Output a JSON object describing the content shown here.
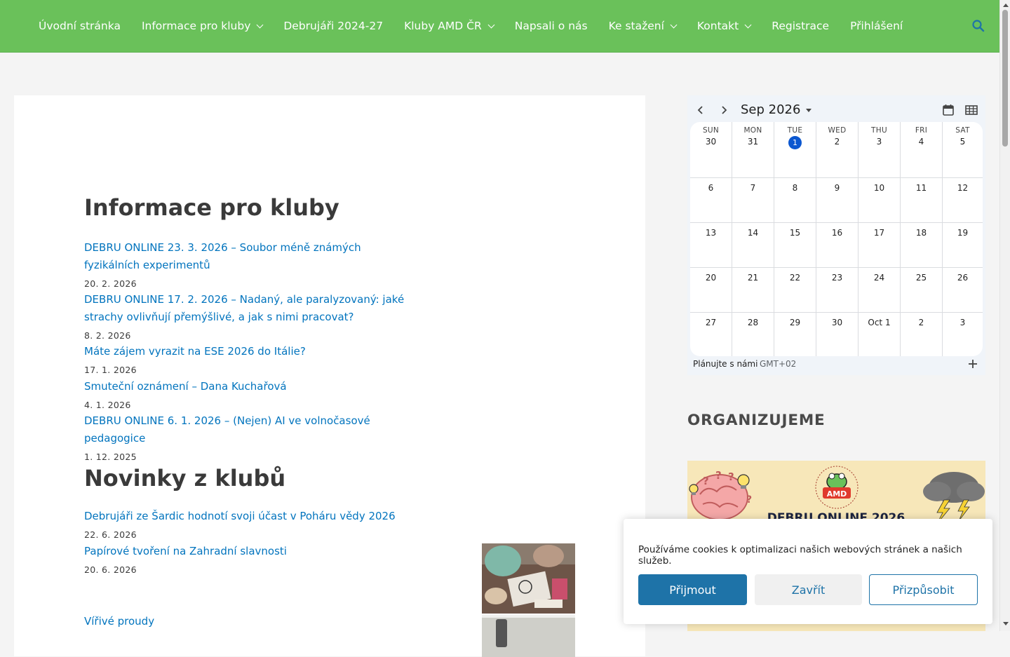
{
  "nav": {
    "items": [
      {
        "label": "Úvodní stránka",
        "has_dropdown": false
      },
      {
        "label": "Informace pro kluby",
        "has_dropdown": true
      },
      {
        "label": "Debrujáři 2024-27",
        "has_dropdown": false
      },
      {
        "label": "Kluby AMD ČR",
        "has_dropdown": true
      },
      {
        "label": "Napsali o nás",
        "has_dropdown": false
      },
      {
        "label": "Ke stažení",
        "has_dropdown": true
      },
      {
        "label": "Kontakt",
        "has_dropdown": true
      },
      {
        "label": "Registrace",
        "has_dropdown": false
      },
      {
        "label": "Přihlášení",
        "has_dropdown": false
      }
    ],
    "search_icon": "search-icon"
  },
  "colors": {
    "header_bg": "#6ac15a",
    "link": "#0274be",
    "today": "#0b57d0",
    "accept_btn": "#1e73a8"
  },
  "main": {
    "info": {
      "title": "Informace pro kluby",
      "posts": [
        {
          "title": "DEBRU ONLINE 23. 3. 2026 – Soubor méně známých fyzikálních experimentů",
          "date": "20. 2. 2026"
        },
        {
          "title": "DEBRU ONLINE 17. 2. 2026 – Nadaný, ale paralyzovaný: jaké strachy ovlivňují přemýšlivé, a jak s nimi pracovat?",
          "date": "8. 2. 2026"
        },
        {
          "title": "Máte zájem vyrazit na ESE 2026 do Itálie?",
          "date": "17. 1. 2026"
        },
        {
          "title": "Smuteční oznámení – Dana Kuchařová",
          "date": "4. 1. 2026"
        },
        {
          "title": "DEBRU ONLINE 6. 1. 2026 – (Nejen) AI ve volnočasové pedagogice",
          "date": "1. 12. 2025"
        }
      ]
    },
    "news": {
      "title": "Novinky z klubů",
      "posts": [
        {
          "title": "Debrujáři ze Šardic hodnotí svoji účast v Poháru vědy 2026",
          "date": "22. 6. 2026"
        },
        {
          "title": "Papírové tvoření na Zahradní slavnosti",
          "date": "20. 6. 2026"
        },
        {
          "title": "Vířivé proudy",
          "date": ""
        }
      ]
    }
  },
  "calendar": {
    "month_label": "Sep 2026",
    "weekdays": [
      "SUN",
      "MON",
      "TUE",
      "WED",
      "THU",
      "FRI",
      "SAT"
    ],
    "weeks": [
      [
        "30",
        "31",
        "1",
        "2",
        "3",
        "4",
        "5"
      ],
      [
        "6",
        "7",
        "8",
        "9",
        "10",
        "11",
        "12"
      ],
      [
        "13",
        "14",
        "15",
        "16",
        "17",
        "18",
        "19"
      ],
      [
        "20",
        "21",
        "22",
        "23",
        "24",
        "25",
        "26"
      ],
      [
        "27",
        "28",
        "29",
        "30",
        "Oct 1",
        "2",
        "3"
      ]
    ],
    "today": "1",
    "calendar_name": "Plánujte s námi",
    "timezone": "GMT+02",
    "icons": [
      "chevron-left-icon",
      "chevron-right-icon",
      "calendar-day-icon",
      "calendar-month-grid-icon",
      "add-icon"
    ]
  },
  "sidebar": {
    "heading": "ORGANIZUJEME",
    "banner_logo_text": "AMD",
    "banner_arc_text": "Asociace malých debrujárů - Česká republika",
    "banner_title": "DEBRU ONLINE 2026"
  },
  "cookie": {
    "text": "Používáme cookies k optimalizaci našich webových stránek a našich služeb.",
    "accept": "Přijmout",
    "close": "Zavřít",
    "customize": "Přizpůsobit"
  }
}
